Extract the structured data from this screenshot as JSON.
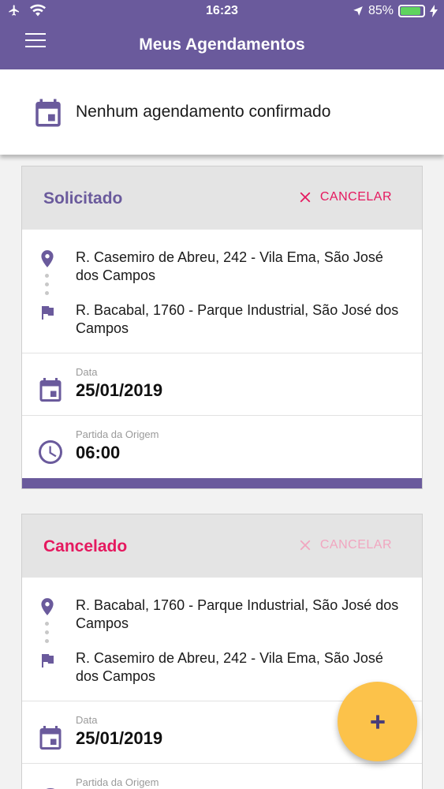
{
  "status_bar": {
    "time": "16:23",
    "battery": "85%",
    "battery_level": 0.85
  },
  "header": {
    "title": "Meus Agendamentos"
  },
  "banner": {
    "text": "Nenhum agendamento confirmado"
  },
  "cards": [
    {
      "status": "Solicitado",
      "status_color": "#6a5a9c",
      "cancel_label": "CANCELAR",
      "cancel_color": "#e5195f",
      "origin": "R. Casemiro de Abreu, 242 - Vila Ema, São José dos Campos",
      "destination": "R. Bacabal, 1760 - Parque Industrial, São José dos Campos",
      "date_label": "Data",
      "date": "25/01/2019",
      "time_label": "Partida da Origem",
      "time": "06:00"
    },
    {
      "status": "Cancelado",
      "status_color": "#e5195f",
      "cancel_label": "CANCELAR",
      "cancel_color": "#f1a6c0",
      "origin": "R. Bacabal, 1760 - Parque Industrial, São José dos Campos",
      "destination": "R. Casemiro de Abreu, 242 - Vila Ema, São José dos Campos",
      "date_label": "Data",
      "date": "25/01/2019",
      "time_label": "Partida da Origem",
      "time": ""
    }
  ],
  "fab": {
    "label": "+",
    "icon": "plus-icon"
  },
  "colors": {
    "primary": "#6a5a9c",
    "accent": "#fcc24a",
    "danger": "#e5195f"
  }
}
